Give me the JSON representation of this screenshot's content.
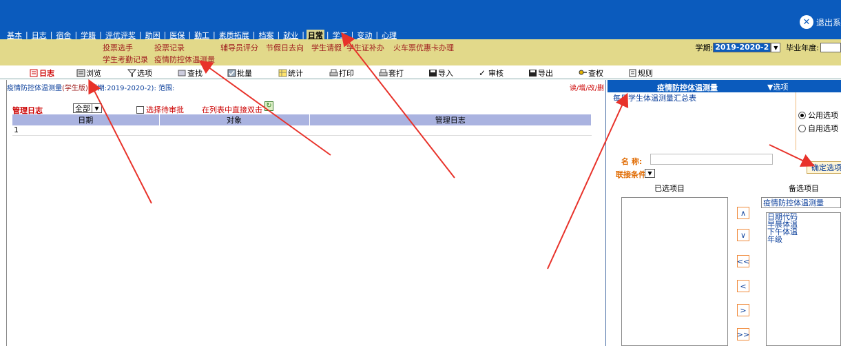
{
  "header": {
    "exit_label": "退出系",
    "nav": [
      "基本",
      "日志",
      "宿舍",
      "学籍",
      "评优评奖",
      "助困",
      "医保",
      "勤工",
      "素质拓展",
      "档案",
      "就业",
      "日常",
      "学工",
      "变动",
      "心理"
    ],
    "active_nav": "日常"
  },
  "submenu": {
    "row1": [
      "投票选手",
      "投票记录",
      "辅导员评分",
      "节假日去向",
      "学生请假",
      "学生证补办",
      "火车票优惠卡办理"
    ],
    "row2": [
      "学生考勤记录",
      "疫情防控体温测量"
    ],
    "term_label": "学期:",
    "term_value": "2019-2020-2",
    "grad_label": "毕业年度:"
  },
  "toolbar": [
    "日志",
    "浏览",
    "选项",
    "查找",
    "批量",
    "统计",
    "打印",
    "套打",
    "导入",
    "审核",
    "导出",
    "查权",
    "规则"
  ],
  "left": {
    "crumb_prefix": "疫情防控体温测量",
    "crumb_red": "(学生版)",
    "crumb_suffix": "(学期:2019-2020-2): 范围:",
    "readonly": "读/增/改/删",
    "mgmt_label": "管理日志",
    "filter_value": "全部",
    "checkbox_label": "选择待审批",
    "direct_label": "在列表中直接双击",
    "columns": [
      "日期",
      "对象",
      "管理日志"
    ],
    "rows": [
      [
        "1",
        "",
        ""
      ]
    ]
  },
  "right": {
    "title": "疫情防控体温测量",
    "option_label": "选项",
    "list_item": "每日学生体温测量汇总表",
    "radio_public": "公用选项",
    "radio_private": "自用选项",
    "name_label": "名  称:",
    "ok_button": "确定选项",
    "cond_label": "联接条件:",
    "selected_label": "已选项目",
    "available_label": "备选项目",
    "available_select": "疫情防控体温测量",
    "available_items": [
      "日期代码",
      "早晨体温",
      "下午体温",
      "年级"
    ],
    "move_buttons": [
      "∧",
      "∨",
      "<<",
      "<",
      ">",
      ">>"
    ]
  }
}
